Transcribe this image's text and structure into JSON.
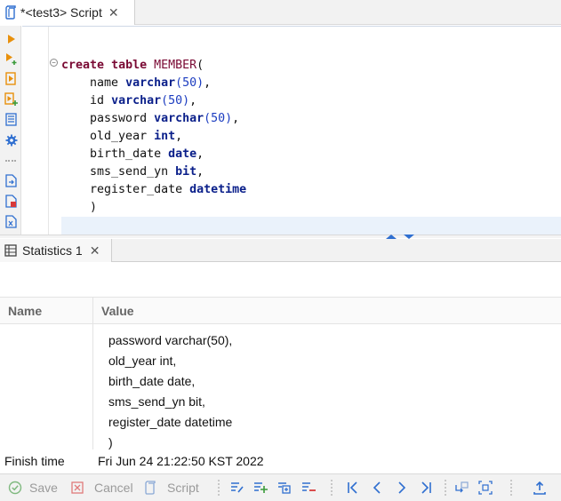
{
  "editor_tab": {
    "title": "*<test3> Script",
    "close": "✕"
  },
  "left_toolbar": {
    "icons": [
      "execute-statement-icon",
      "execute-in-new-tab-icon",
      "execute-script-icon",
      "execute-script-new-tabs-icon",
      "explain-plan-icon",
      "settings-gear-icon",
      "load-script-icon",
      "save-script-icon",
      "export-icon"
    ]
  },
  "code": {
    "line1": {
      "kw1": "create",
      "kw2": "table",
      "name": "MEMBER",
      "paren": "("
    },
    "lines": [
      {
        "col": "name",
        "type": "varchar",
        "args": "(50)",
        "tail": ","
      },
      {
        "col": "id",
        "type": "varchar",
        "args": "(50)",
        "tail": ","
      },
      {
        "col": "password",
        "type": "varchar",
        "args": "(50)",
        "tail": ","
      },
      {
        "col": "old_year",
        "type": "int",
        "args": "",
        "tail": ","
      },
      {
        "col": "birth_date",
        "type": "date",
        "args": "",
        "tail": ","
      },
      {
        "col": "sms_send_yn",
        "type": "bit",
        "args": "",
        "tail": ","
      },
      {
        "col": "register_date",
        "type": "datetime",
        "args": "",
        "tail": ""
      }
    ],
    "closing": ")"
  },
  "results_tab": {
    "title": "Statistics 1",
    "close": "✕"
  },
  "grid": {
    "headers": {
      "name": "Name",
      "value": "Value"
    },
    "value_lines": [
      "password varchar(50),",
      "old_year int,",
      "birth_date date,",
      "sms_send_yn bit,",
      "register_date datetime",
      ")"
    ],
    "finish": {
      "name": "Finish time",
      "value": "Fri Jun 24 21:22:50 KST 2022"
    }
  },
  "bottom_toolbar": {
    "save": "Save",
    "cancel": "Cancel",
    "script": "Script"
  },
  "colors": {
    "keyword": "#7a0a34",
    "type": "#0a1f8a",
    "number": "#1b3cc0",
    "current_line": "#eaf2fb",
    "icon_orange": "#e8900c",
    "icon_blue": "#2f6fd0"
  }
}
